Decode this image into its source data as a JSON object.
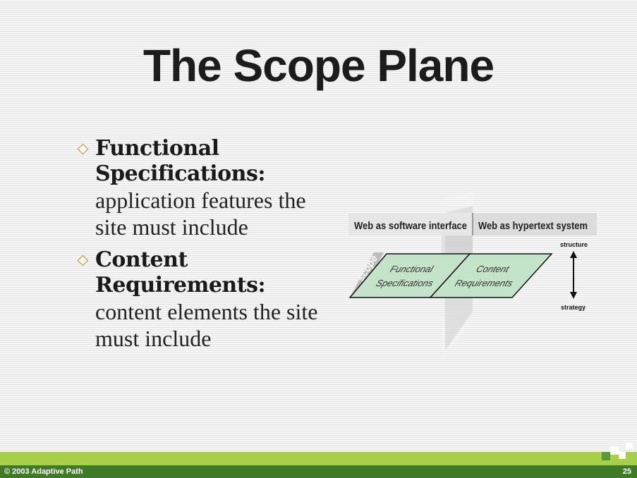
{
  "slide": {
    "title": "The Scope Plane",
    "page_number": "25",
    "copyright": "© 2003 Adaptive Path"
  },
  "bullets": [
    {
      "heading": "Functional Specifications:",
      "body": "application features the site must include"
    },
    {
      "heading": "Content Requirements:",
      "body": "content elements the site must include"
    }
  ],
  "diagram": {
    "header_left": "Web as software interface",
    "header_right": "Web as hypertext system",
    "plane_label": "scope",
    "cell_left_line1": "Functional",
    "cell_left_line2": "Specifications",
    "cell_right_line1": "Content",
    "cell_right_line2": "Requirements",
    "axis_top": "structure",
    "axis_bottom": "strategy"
  },
  "colors": {
    "footer_green_light": "#a7cf48",
    "footer_green_dark": "#3f7a26",
    "plane_fill": "#c4e4c9"
  }
}
